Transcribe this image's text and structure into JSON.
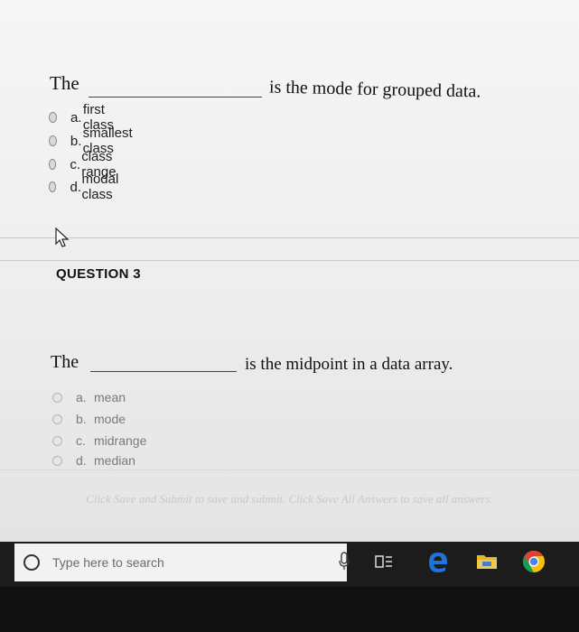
{
  "question_prev": {
    "stem_lead": "The",
    "stem_rest": "is the mode for grouped data.",
    "options": [
      {
        "letter": "a.",
        "text": "first class"
      },
      {
        "letter": "b.",
        "text": "smallest class"
      },
      {
        "letter": "c.",
        "text": "class range"
      },
      {
        "letter": "d.",
        "text": "modal class"
      }
    ]
  },
  "question3": {
    "header": "QUESTION 3",
    "stem_lead": "The",
    "stem_rest": "is the midpoint in a data array.",
    "options": [
      {
        "letter": "a.",
        "text": "mean"
      },
      {
        "letter": "b.",
        "text": "mode"
      },
      {
        "letter": "c.",
        "text": "midrange"
      },
      {
        "letter": "d.",
        "text": "median"
      }
    ]
  },
  "footer": {
    "instruction": "Click Save and Submit to save and submit. Click Save All Answers to save all answers."
  },
  "taskbar": {
    "search_placeholder": "Type here to search",
    "icons": [
      "microphone-icon",
      "task-view-icon",
      "edge-icon",
      "file-explorer-icon",
      "chrome-icon"
    ]
  },
  "colors": {
    "edge_blue": "#1e73d8",
    "chrome_yellow": "#f4c20d",
    "explorer_yellow": "#e8b530"
  }
}
